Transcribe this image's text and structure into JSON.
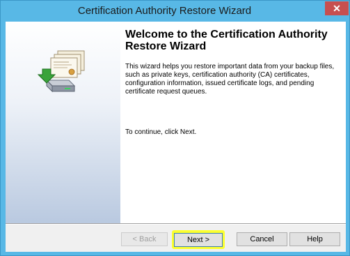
{
  "window": {
    "title": "Certification Authority Restore Wizard",
    "close_glyph": "✕"
  },
  "welcome": {
    "heading": "Welcome to the Certification Authority Restore Wizard",
    "description": "This wizard helps you restore important data from your backup files, such as private keys, certification authority (CA) certificates, configuration information, issued certificate logs, and pending certificate request queues.",
    "continue_text": "To continue, click Next."
  },
  "buttons": {
    "back": "< Back",
    "next": "Next >",
    "cancel": "Cancel",
    "help": "Help"
  },
  "colors": {
    "titlebar": "#58b8e6",
    "highlight": "#fbff2f",
    "close": "#c74f4f"
  },
  "icons": {
    "wizard_graphic": "certificates-restore-disk-icon",
    "close": "close-icon"
  }
}
